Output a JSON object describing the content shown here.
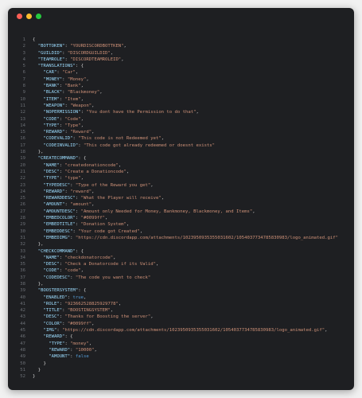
{
  "window": {
    "controls": [
      "close",
      "minimize",
      "maximize"
    ]
  },
  "code": {
    "lines": [
      "{",
      "  \"BOTTOKEN\": \"YOURDISCORDBOTTKEN\",",
      "  \"GUILDID\": \"DISCORDGUILDID\",",
      "  \"TEAMROLE\": \"DISCORDTEAMROLEID\",",
      "  \"TRANSLATIONS\": {",
      "    \"CAR\": \"Car\",",
      "    \"MONEY\": \"Money\",",
      "    \"BANK\": \"Bank\",",
      "    \"BLACK\": \"Blackmoney\",",
      "    \"ITEM\": \"Item\",",
      "    \"WEAPON\": \"Weapon\",",
      "    \"NOPERMISSION\": \"You dont have the Permission to do that\",",
      "    \"CODE\": \"Code\",",
      "    \"TYPE\": \"Type\",",
      "    \"REWARD\": \"Reward\",",
      "    \"CODEVALID\": \"This code is not Redeemed yet\",",
      "    \"CODEINVALID\": \"This code got already redeemed or doesnt exists\"",
      "  },",
      "  \"CREATECOMMAND\": {",
      "    \"NAME\": \"createdonationcode\",",
      "    \"DESC\": \"Create a Donationcode\",",
      "    \"TYPE\": \"type\",",
      "    \"TYPEDESC\": \"Type of the Reward you get\",",
      "    \"REWARD\": \"reward\",",
      "    \"REWARDDESC\": \"What the Player will receive\",",
      "    \"AMOUNT\": \"amount\",",
      "    \"AMOUNTDESC\": \"Amount only Needed for Money, Bankmoney, Blackmoney, and Items\",",
      "    \"EMBEDCOLOR\": \"#0099ff\",",
      "    \"EMBEDTITLE\": \"Donation System\",",
      "    \"EMBEDDESC\": \"Your code got Created\",",
      "    \"EMBEDIMG\": \"https://cdn.discordapp.com/attachments/1023950935355031602/1054037734785830983/logo_animated.gif\"",
      "  },",
      "  \"CHECKCOMMAND\": {",
      "    \"NAME\": \"checkdonatorcode\",",
      "    \"DESC\": \"Check a Donatorcode if its Valid\",",
      "    \"CODE\": \"code\",",
      "    \"CODEDESC\": \"The code you want to check\"",
      "  },",
      "  \"BOOSTERSYSTEM\": {",
      "    \"ENABLED\": true,",
      "    \"ROLE\": \"923662528825929778\",",
      "    \"TITLE\": \"BOOSTINGSYSTEM\",",
      "    \"DESC\": \"Thanks for Boosting the server\",",
      "    \"COLOR\": \"#0099ff\",",
      "    \"IMG\": \"https://cdn.discordapp.com/attachments/1023950935355031602/1054037734785830983/logo_animated.gif\",",
      "    \"REWARD\": {",
      "      \"TYPE\": \"money\",",
      "      \"REWARD\": \"10000\",",
      "      \"AMOUNT\": false",
      "    }",
      "  }",
      "}"
    ]
  }
}
